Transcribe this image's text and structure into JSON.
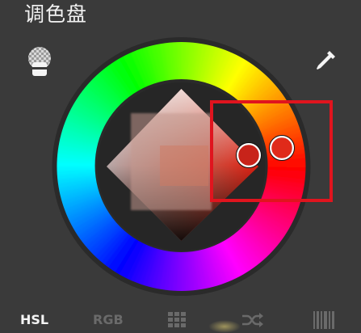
{
  "header": {
    "title": "调色盘"
  },
  "icons": {
    "layer": "layer-stack-icon",
    "dropper": "eyedropper-icon",
    "grid": "grid-icon",
    "shuffle": "shuffle-icon",
    "bars": "barcode-icon"
  },
  "tabs": {
    "hsl": "HSL",
    "rgb": "RGB"
  },
  "colors": {
    "background": "#3a3a3a",
    "highlight_box": "#e0141e",
    "selected_color": "#e02a1a",
    "active_tab": "#f4f4f4",
    "inactive_tab": "#6a6a6a"
  }
}
